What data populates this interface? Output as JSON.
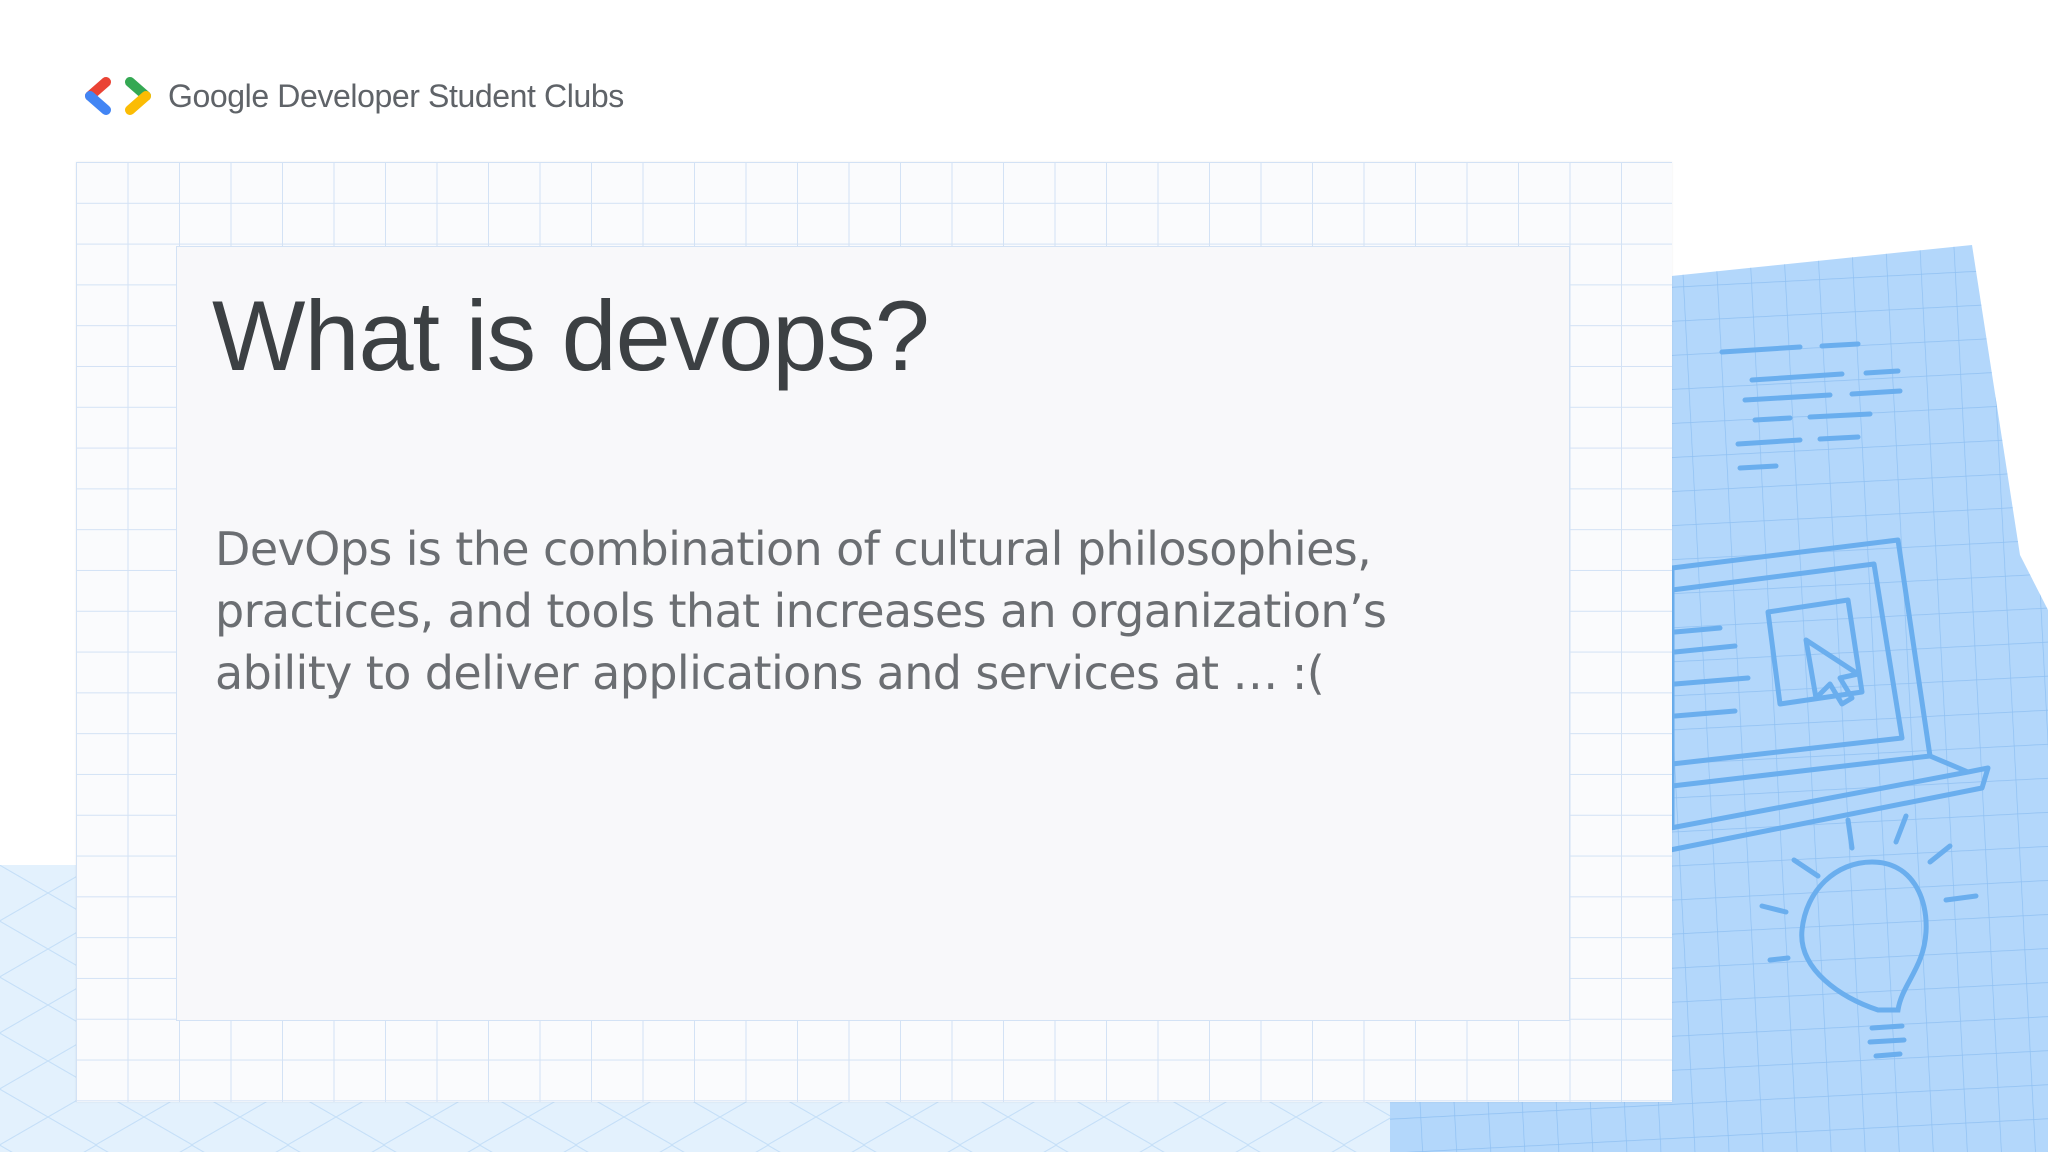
{
  "brand": {
    "logo_icon": "gdsc-brackets-logo",
    "name": "Google Developer Student Clubs",
    "logo_colors": {
      "red": "#ea4335",
      "blue": "#4285f4",
      "green": "#34a853",
      "yellow": "#fbbc04"
    }
  },
  "slide": {
    "title": "What is devops?",
    "body": "DevOps is the combination of cultural philosophies, practices, and tools that increases an organization’s ability to deliver applications and services at … :("
  },
  "decorations": {
    "right_panel_icons": [
      "code-lines-icon",
      "laptop-icon",
      "cursor-icon",
      "lightbulb-icon"
    ],
    "accent_color": "#a8d0f8"
  }
}
